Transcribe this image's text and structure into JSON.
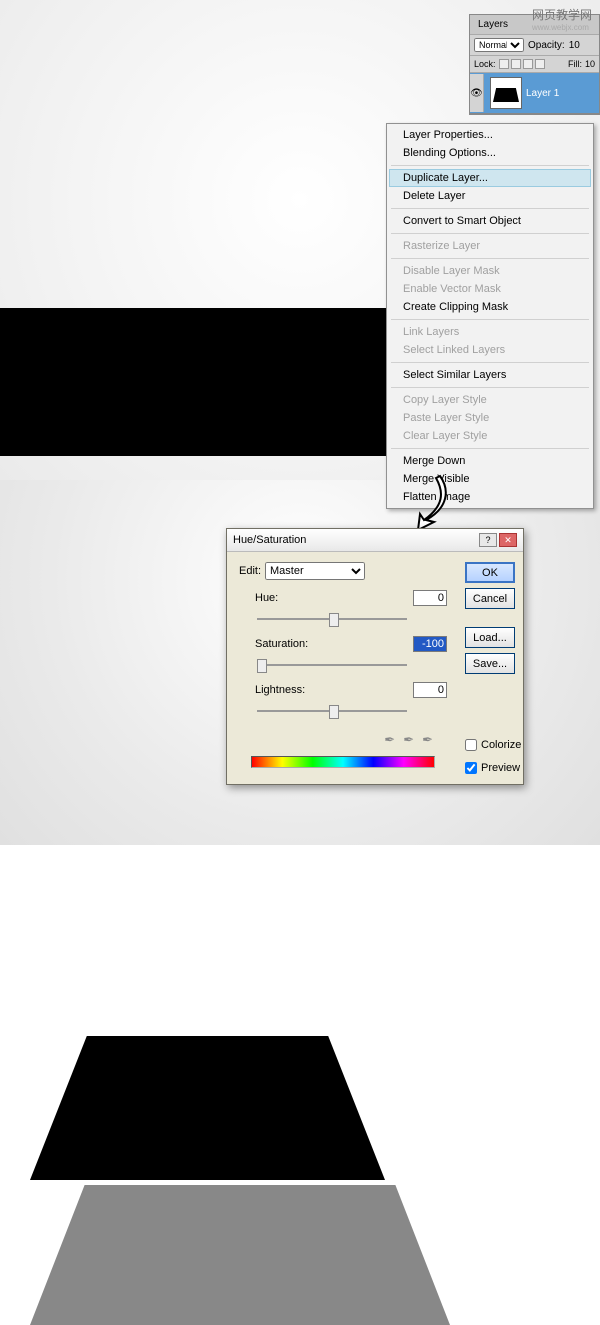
{
  "watermark": {
    "title": "网页教学网",
    "url": "www.webjx.com"
  },
  "layersPanel": {
    "tab": "Layers",
    "blendMode": "Normal",
    "opacityLabel": "Opacity:",
    "opacityValue": "10",
    "lockLabel": "Lock:",
    "fillLabel": "Fill:",
    "fillValue": "10",
    "layer": {
      "name": "Layer 1"
    }
  },
  "contextMenu": {
    "items": [
      {
        "label": "Layer Properties...",
        "enabled": true
      },
      {
        "label": "Blending Options...",
        "enabled": true
      },
      {
        "label": "Duplicate Layer...",
        "enabled": true,
        "highlighted": true
      },
      {
        "label": "Delete Layer",
        "enabled": true
      },
      {
        "label": "Convert to Smart Object",
        "enabled": true
      },
      {
        "label": "Rasterize Layer",
        "enabled": false
      },
      {
        "label": "Disable Layer Mask",
        "enabled": false
      },
      {
        "label": "Enable Vector Mask",
        "enabled": false
      },
      {
        "label": "Create Clipping Mask",
        "enabled": true
      },
      {
        "label": "Link Layers",
        "enabled": false
      },
      {
        "label": "Select Linked Layers",
        "enabled": false
      },
      {
        "label": "Select Similar Layers",
        "enabled": true
      },
      {
        "label": "Copy Layer Style",
        "enabled": false
      },
      {
        "label": "Paste Layer Style",
        "enabled": false
      },
      {
        "label": "Clear Layer Style",
        "enabled": false
      },
      {
        "label": "Merge Down",
        "enabled": true
      },
      {
        "label": "Merge Visible",
        "enabled": true
      },
      {
        "label": "Flatten Image",
        "enabled": true
      }
    ]
  },
  "hueDialog": {
    "title": "Hue/Saturation",
    "editLabel": "Edit:",
    "editValue": "Master",
    "hueLabel": "Hue:",
    "hueValue": "0",
    "satLabel": "Saturation:",
    "satValue": "-100",
    "lightLabel": "Lightness:",
    "lightValue": "0",
    "buttons": {
      "ok": "OK",
      "cancel": "Cancel",
      "load": "Load...",
      "save": "Save..."
    },
    "colorizeLabel": "Colorize",
    "previewLabel": "Preview"
  }
}
